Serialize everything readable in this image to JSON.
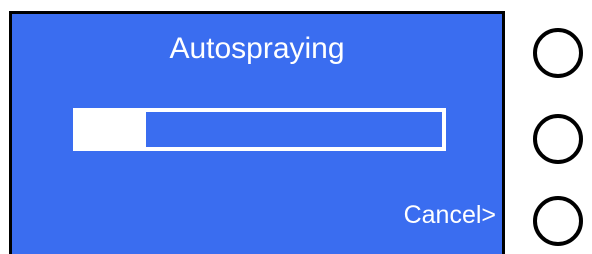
{
  "screen": {
    "title": "Autospraying",
    "progress": 0.19,
    "softkey_bottom_label": "Cancel>"
  },
  "colors": {
    "screen_background": "#3a6df0",
    "foreground": "#ffffff",
    "bezel": "#000000"
  },
  "buttons": [
    {
      "name": "top-softkey-button",
      "icon": "circle-button"
    },
    {
      "name": "middle-softkey-button",
      "icon": "circle-button"
    },
    {
      "name": "bottom-softkey-button",
      "icon": "circle-button"
    }
  ]
}
